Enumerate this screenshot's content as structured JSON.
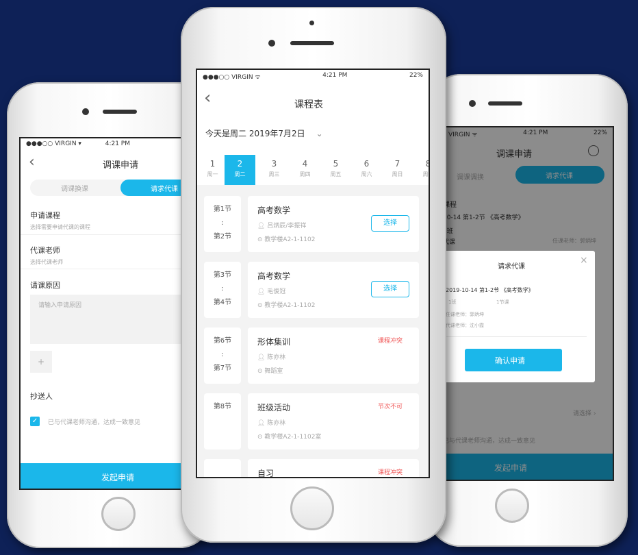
{
  "left_phone": {
    "status": {
      "carrier": "●●●○○ VIRGIN ▾",
      "time": "4:21 PM"
    },
    "title": "调课申请",
    "tabs": [
      "调课换课",
      "请求代课"
    ],
    "fields": [
      {
        "label": "申请课程",
        "placeholder": "选择需要申请代课的课程"
      },
      {
        "label": "代课老师",
        "placeholder": "选择代课老师"
      }
    ],
    "reason_label": "请课原因",
    "reason_placeholder": "请输入申请原因",
    "add": "+",
    "cc_label": "抄送人",
    "agree_text": "已与代课老师沟通，达成一致意见",
    "submit": "发起申请"
  },
  "center_phone": {
    "status": {
      "carrier": "●●●○○ VIRGIN ᯤ",
      "time": "4:21 PM",
      "battery": "22%"
    },
    "title": "课程表",
    "date_text": "今天是周二 2019年7月2日",
    "date_chevron": "⌄",
    "days": [
      {
        "num": "1",
        "label": "周一"
      },
      {
        "num": "2",
        "label": "周二"
      },
      {
        "num": "3",
        "label": "周三"
      },
      {
        "num": "4",
        "label": "周四"
      },
      {
        "num": "5",
        "label": "周五"
      },
      {
        "num": "6",
        "label": "周六"
      },
      {
        "num": "7",
        "label": "周日"
      },
      {
        "num": "8",
        "label": "周一"
      }
    ],
    "selected_day": "2",
    "lessons": [
      {
        "period_start": "第1节",
        "sep": ":",
        "period_end": "第2节",
        "course": "高考数学",
        "teacher": "吕炳辰/李振祥",
        "room": "教学楼A2-1-1102",
        "action": "选择",
        "status": ""
      },
      {
        "period_start": "第3节",
        "sep": ":",
        "period_end": "第4节",
        "course": "高考数学",
        "teacher": "毛俊冠",
        "room": "教学楼A2-1-1102",
        "action": "选择",
        "status": ""
      },
      {
        "period_start": "第6节",
        "sep": ":",
        "period_end": "第7节",
        "course": "形体集训",
        "teacher": "陈亦林",
        "room": "舞蹈室",
        "action": "",
        "status": "课程冲突"
      },
      {
        "period_start": "",
        "sep": "第8节",
        "period_end": "",
        "course": "班级活动",
        "teacher": "陈亦林",
        "room": "教学楼A2-1-1102室",
        "action": "",
        "status": "节次不可"
      },
      {
        "period_start": "",
        "sep": "",
        "period_end": "",
        "course": "自习",
        "teacher": "",
        "room": "",
        "action": "",
        "status": "课程冲突"
      }
    ]
  },
  "right_phone": {
    "status": {
      "carrier": "VIRGIN ᯤ",
      "time": "4:21 PM",
      "battery": "22%"
    },
    "title": "调课申请",
    "tabs": [
      "调课调换",
      "请求代课"
    ],
    "course_label": "课程",
    "course_value": "10-14 第1-2节 《高考数学》",
    "class": "1班",
    "sub_label": "代课",
    "sub_right": "任课老师：郭炳坤",
    "cc_right": "请选择 ›",
    "agree_text": "已与代课老师沟通，达成一致意见",
    "submit": "发起申请",
    "modal": {
      "title": "请求代课",
      "close": "×",
      "line1": "2019-10-14 第1-2节 《高考数学》",
      "line2a": "1班",
      "line2b": "1节课",
      "line3": "任课老师：郭炳坤",
      "line4": "代课老师：沈小霞",
      "confirm": "确认申请"
    }
  },
  "colors": {
    "accent": "#1bb7ea",
    "danger": "#f05a5a",
    "background": "#0e2157"
  }
}
